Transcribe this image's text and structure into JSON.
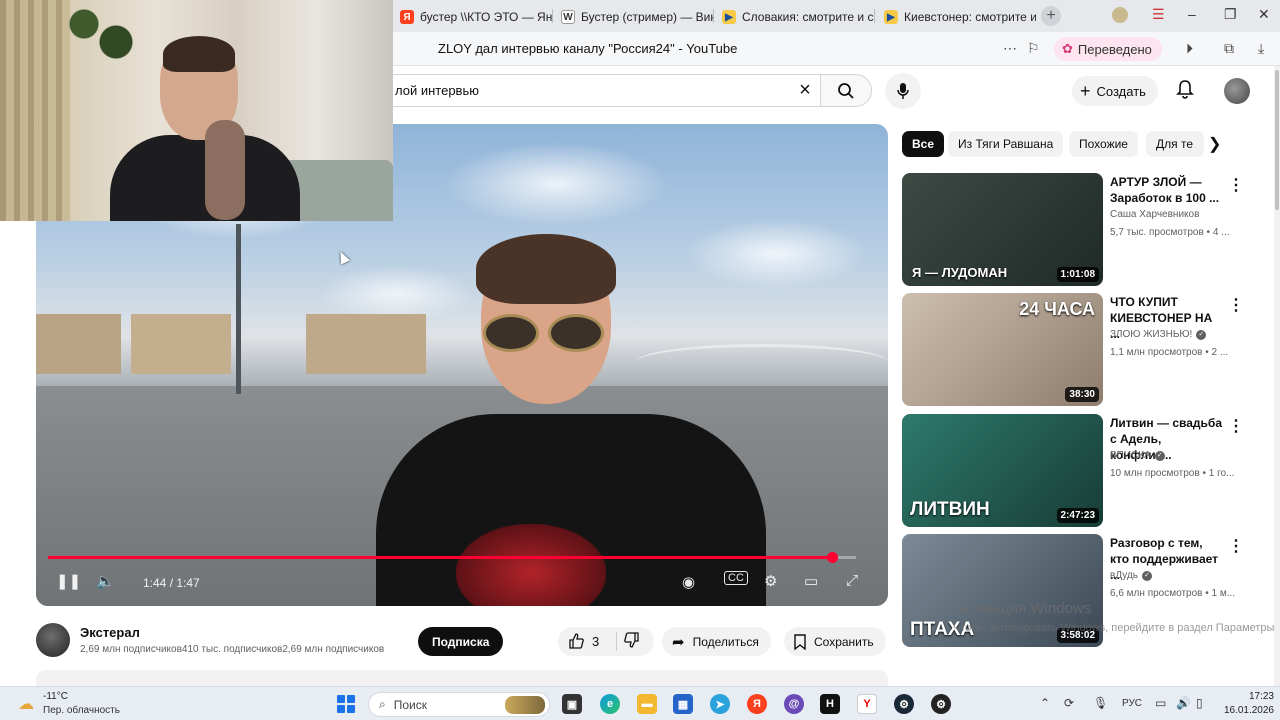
{
  "browser": {
    "tabs": [
      {
        "label": "бустер \\\\КТО ЭТО — Янд",
        "favicon": "Я",
        "color": "#fc3f1d"
      },
      {
        "label": "Бустер (стример) — Вик",
        "favicon": "W",
        "color": "#555555"
      },
      {
        "label": "Словакия: смотрите и ск",
        "favicon": "▶",
        "color": "#f7c948"
      },
      {
        "label": "Киевстонер: смотрите и",
        "favicon": "▶",
        "color": "#f7c948"
      }
    ],
    "page_title": "ZLOY дал интервью каналу \"Россия24\" - YouTube",
    "translated_label": "Переведено"
  },
  "youtube": {
    "search_value": "лой интервью",
    "create_label": "Создать"
  },
  "player": {
    "time": "1:44 / 1:47",
    "progress": 0.97
  },
  "channel": {
    "name": "Экстерал",
    "subs": "2,69 млн подписчиков410 тыс. подписчиков2,69 млн подписчиков",
    "subscribe_label": "Подписка",
    "likes": "3",
    "share_label": "Поделиться",
    "save_label": "Сохранить"
  },
  "chips": [
    "Все",
    "Из Тяги Равшана",
    "Похожие",
    "Для те"
  ],
  "recommended": [
    {
      "title": "АРТУР ЗЛОЙ — Заработок в 100 ...",
      "channel": "Саша Харчевников",
      "verified": false,
      "meta": "5,7 тыс. просмотров • 4 ...",
      "duration": "1:01:08",
      "thumb_text": "Я — ЛУДОМАН",
      "thumb_color": "#2c3a33"
    },
    {
      "title": "ЧТО КУПИТ КИЕВСТОНЕР НА ...",
      "channel": "ЗЛОЮ ЖИЗНЬЮ!",
      "verified": true,
      "meta": "1,1 млн просмотров • 2 ...",
      "duration": "38:30",
      "thumb_text": "24 ЧАСА",
      "thumb_color": "#b7a999"
    },
    {
      "title": "Литвин — свадьба с Адель, конфлик...",
      "channel": "ВПИСКА",
      "verified": true,
      "meta": "10 млн просмотров • 1 го...",
      "duration": "2:47:23",
      "thumb_text": "ЛИТВИН",
      "thumb_color": "#2b6a5e"
    },
    {
      "title": "Разговор с тем, кто поддерживает ...",
      "channel": "вДудь",
      "verified": true,
      "meta": "6,6 млн просмотров • 1 м...",
      "duration": "3:58:02",
      "thumb_text": "ПТАХА",
      "thumb_color": "#5a6a78"
    }
  ],
  "windows": {
    "activation_title": "Активация Windows",
    "activation_sub": "Чтобы активировать Windows, перейдите в раздел Параметры."
  },
  "taskbar": {
    "temp": "-11°C",
    "weather": "Пер. облачность",
    "search_placeholder": "Поиск",
    "lang": "РУС",
    "time": "17:23",
    "date": "16.01.2026"
  }
}
